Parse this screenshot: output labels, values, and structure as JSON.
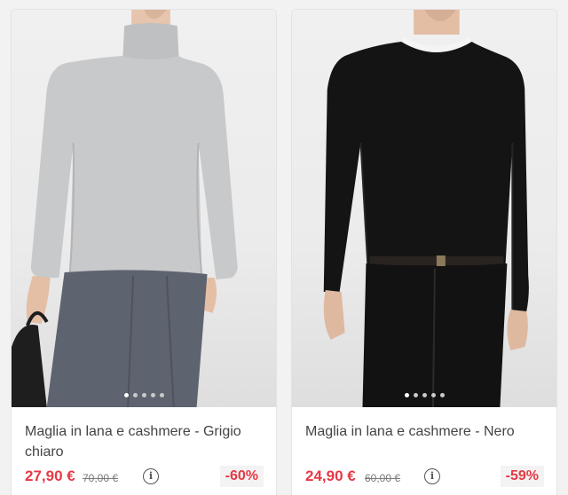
{
  "products": [
    {
      "name": "Maglia in lana e cashmere - Grigio chiaro",
      "price": "27,90 €",
      "old_price": "70,00 €",
      "discount": "-60%",
      "image_dots": 5,
      "active_dot": 0,
      "info_icon": "info-icon",
      "colors": {
        "price": "#e63946",
        "sweater": "#c8c9cb",
        "trousers": "#5d636f"
      }
    },
    {
      "name": "Maglia in lana e cashmere - Nero",
      "price": "24,90 €",
      "old_price": "60,00 €",
      "discount": "-59%",
      "image_dots": 5,
      "active_dot": 0,
      "info_icon": "info-icon",
      "colors": {
        "price": "#e63946",
        "sweater": "#141414",
        "trousers": "#121212"
      }
    }
  ]
}
